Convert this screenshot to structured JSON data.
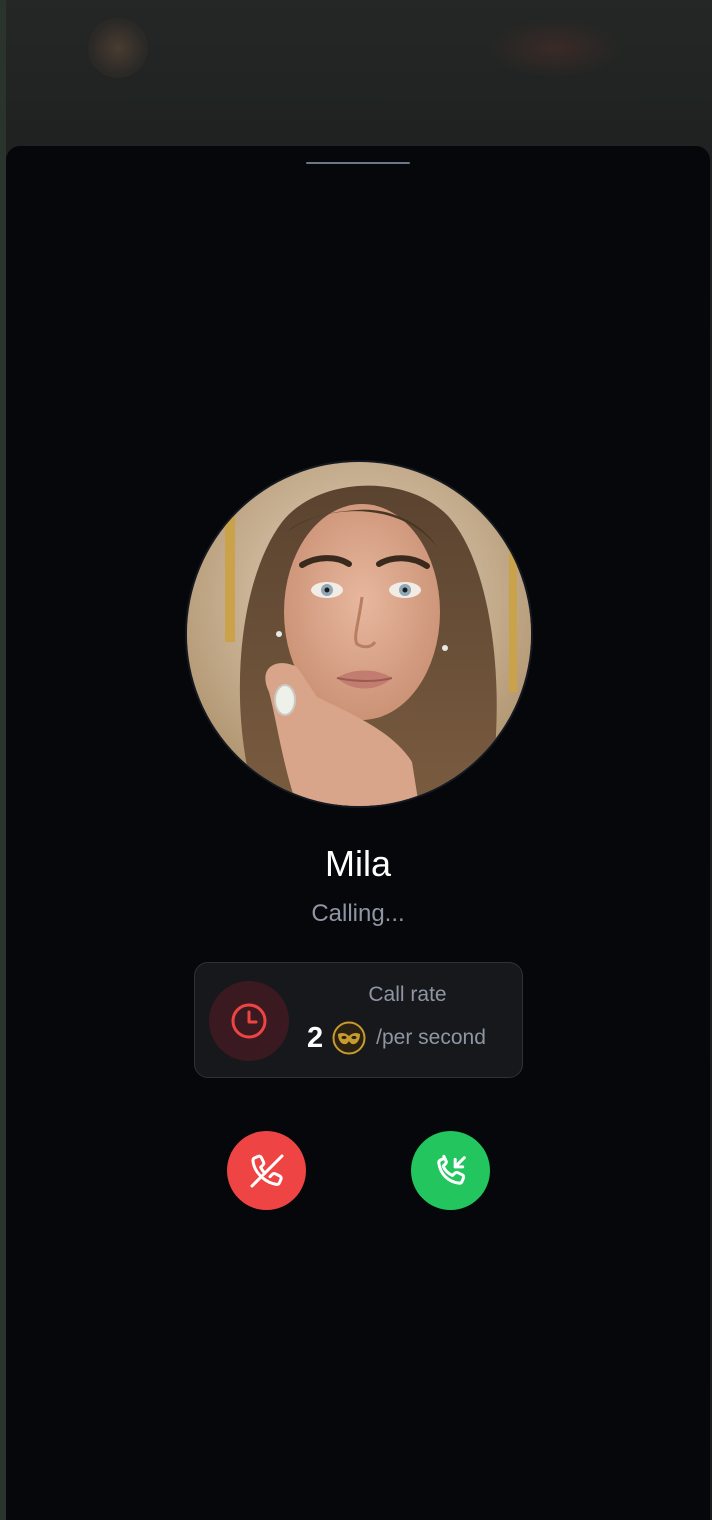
{
  "caller": {
    "name": "Mila",
    "status": "Calling..."
  },
  "call_rate": {
    "label": "Call rate",
    "value": "2",
    "unit": "/per second",
    "icon": "clock-icon",
    "currency_icon": "coin-mask-icon"
  },
  "actions": {
    "decline_icon": "phone-off-icon",
    "accept_icon": "phone-incoming-icon"
  },
  "colors": {
    "sheet_background": "#05070a",
    "decline": "#ef4444",
    "accept": "#22c55e",
    "clock_accent": "#ef4444",
    "coin": "#c89b2e",
    "muted_text": "#8f96a3"
  }
}
